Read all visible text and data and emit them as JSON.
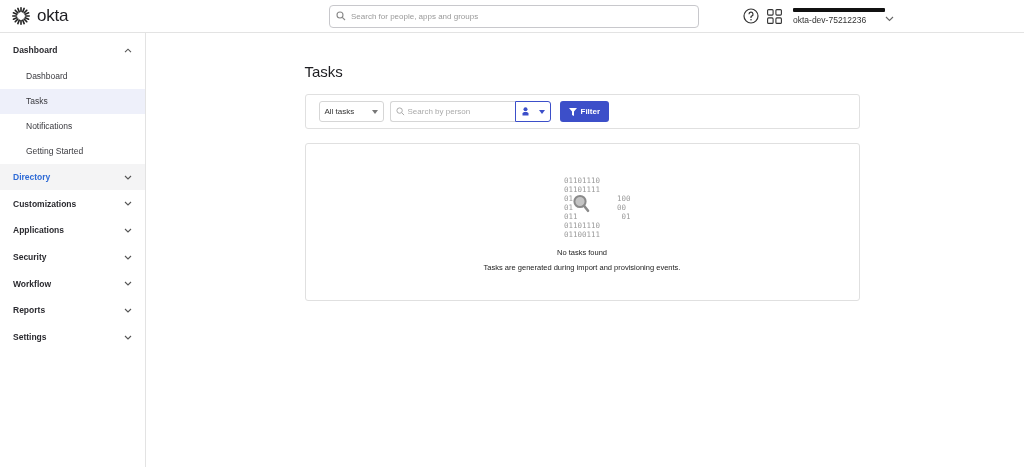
{
  "header": {
    "logo": "okta",
    "search": {
      "placeholder": "Search for people, apps and groups"
    },
    "account": {
      "org": "okta-dev-75212236"
    }
  },
  "sidebar": {
    "sections": [
      {
        "label": "Dashboard",
        "expanded": true,
        "selected": false,
        "children": [
          {
            "label": "Dashboard",
            "selected": false
          },
          {
            "label": "Tasks",
            "selected": true
          },
          {
            "label": "Notifications",
            "selected": false
          },
          {
            "label": "Getting Started",
            "selected": false
          }
        ]
      },
      {
        "label": "Directory",
        "expanded": false,
        "selected": true
      },
      {
        "label": "Customizations",
        "expanded": false,
        "selected": false
      },
      {
        "label": "Applications",
        "expanded": false,
        "selected": false
      },
      {
        "label": "Security",
        "expanded": false,
        "selected": false
      },
      {
        "label": "Workflow",
        "expanded": false,
        "selected": false
      },
      {
        "label": "Reports",
        "expanded": false,
        "selected": false
      },
      {
        "label": "Settings",
        "expanded": false,
        "selected": false
      }
    ]
  },
  "page": {
    "title": "Tasks",
    "toolbar": {
      "dropdown": "All tasks",
      "search": {
        "placeholder": "Search by person"
      },
      "filter_button": "Filter"
    },
    "empty_state": {
      "binary": [
        [
          "01101110"
        ],
        [
          "01101111"
        ],
        [
          "01",
          "100"
        ],
        [
          "01",
          "00"
        ],
        [
          "011",
          "01"
        ],
        [
          "01101110"
        ],
        [
          "01100111"
        ]
      ],
      "title": "No tasks found",
      "message": "Tasks are generated during import and provisioning events."
    }
  }
}
